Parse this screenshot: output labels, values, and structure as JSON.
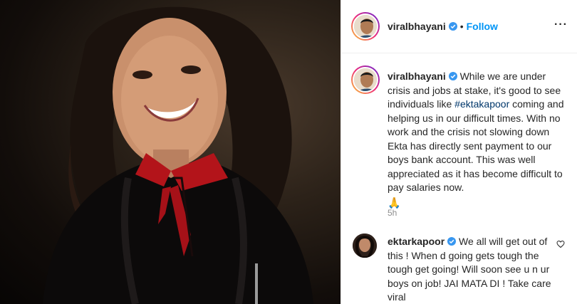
{
  "header": {
    "username": "viralbhayani",
    "separator": "•",
    "follow_label": "Follow",
    "more_label": "···"
  },
  "caption": {
    "username": "viralbhayani",
    "text_before": "While we are under crisis and jobs at stake, it's good to see individuals like ",
    "hashtag": "#ektakapoor",
    "text_after": " coming and helping us in our difficult times. With no work and the crisis not slowing down Ekta has directly sent payment to our boys bank account. This was well appreciated as it has become difficult to pay salaries now.",
    "emoji": "🙏",
    "time": "5h"
  },
  "comment": {
    "username": "ektarkapoor",
    "text": "We all will get out of this ! When d going gets tough the tough get going! Will soon see u n ur boys on job! JAI MATA DI ! Take care viral"
  },
  "colors": {
    "accent": "#0095f6",
    "hashtag": "#00376b",
    "verified": "#3897f0",
    "meta": "#8e8e8e"
  },
  "icons": [
    "verified-badge-icon",
    "more-options-icon",
    "heart-icon",
    "folded-hands-emoji"
  ]
}
